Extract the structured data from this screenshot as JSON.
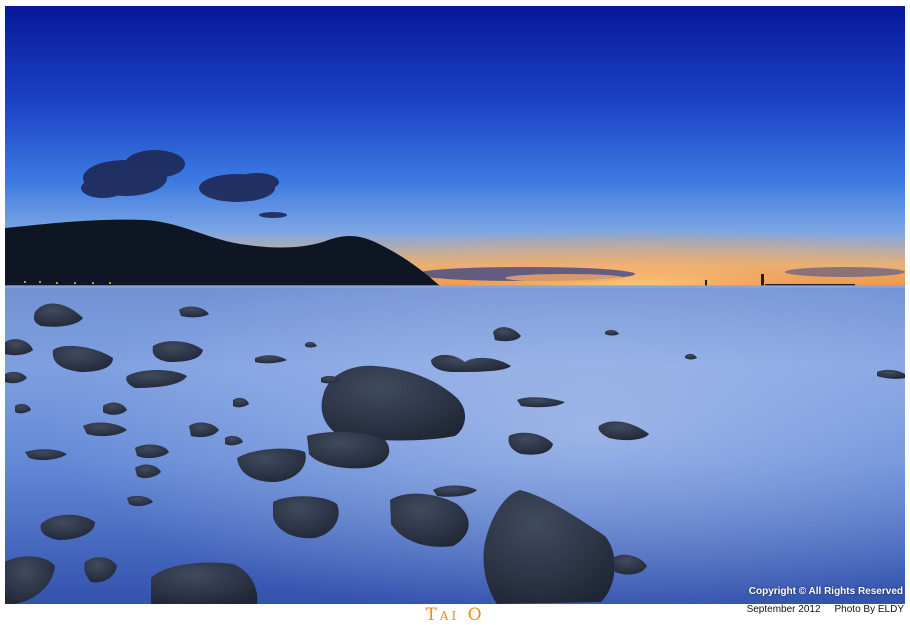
{
  "photo": {
    "subject": "coastal-sunset-rocks",
    "colors": {
      "sky_top": "#0a1f9e",
      "sky_mid": "#2f63d6",
      "horizon_glow": "#f2a04a",
      "water": "#5a86d8",
      "rocks": "#1c2230",
      "hill": "#111a2a"
    }
  },
  "caption": {
    "title": "Tai O"
  },
  "credits": {
    "copyright": "Copyright © All Rights Reserved",
    "date": "September 2012",
    "photographer": "Photo By ELDY"
  }
}
